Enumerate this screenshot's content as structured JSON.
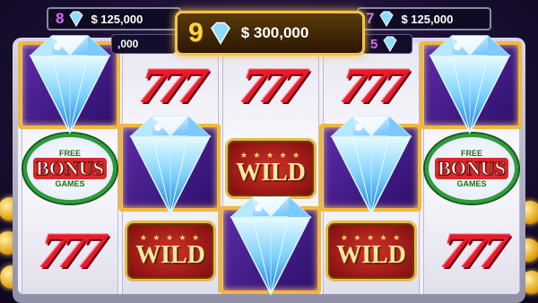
{
  "jackpots": {
    "left_top": {
      "count": "8",
      "amount": "$ 125,000"
    },
    "left_back": {
      "amount": ",000"
    },
    "center": {
      "count": "9",
      "amount": "$ 300,000"
    },
    "right_top": {
      "count": "7",
      "amount": "$ 125,000"
    },
    "right_back": {
      "count": "5"
    }
  },
  "reels": [
    [
      "diamond",
      "bonus",
      "sevens"
    ],
    [
      "sevens",
      "diamond",
      "wild"
    ],
    [
      "sevens",
      "wild",
      "diamond"
    ],
    [
      "sevens",
      "diamond",
      "wild"
    ],
    [
      "diamond",
      "bonus",
      "sevens"
    ]
  ],
  "symbols": {
    "sevens": "777",
    "wild": "WILD",
    "wild_stars": "★ ★ ★ ★ ★",
    "bonus_top": "FREE",
    "bonus_mid": "BONUS",
    "bonus_bottom": "GAMES"
  },
  "colors": {
    "accent_gold": "#f3c24a",
    "seven_red": "#e81b2c",
    "bonus_green": "#2e9b3a",
    "jackpot_purple": "#d46bff"
  }
}
